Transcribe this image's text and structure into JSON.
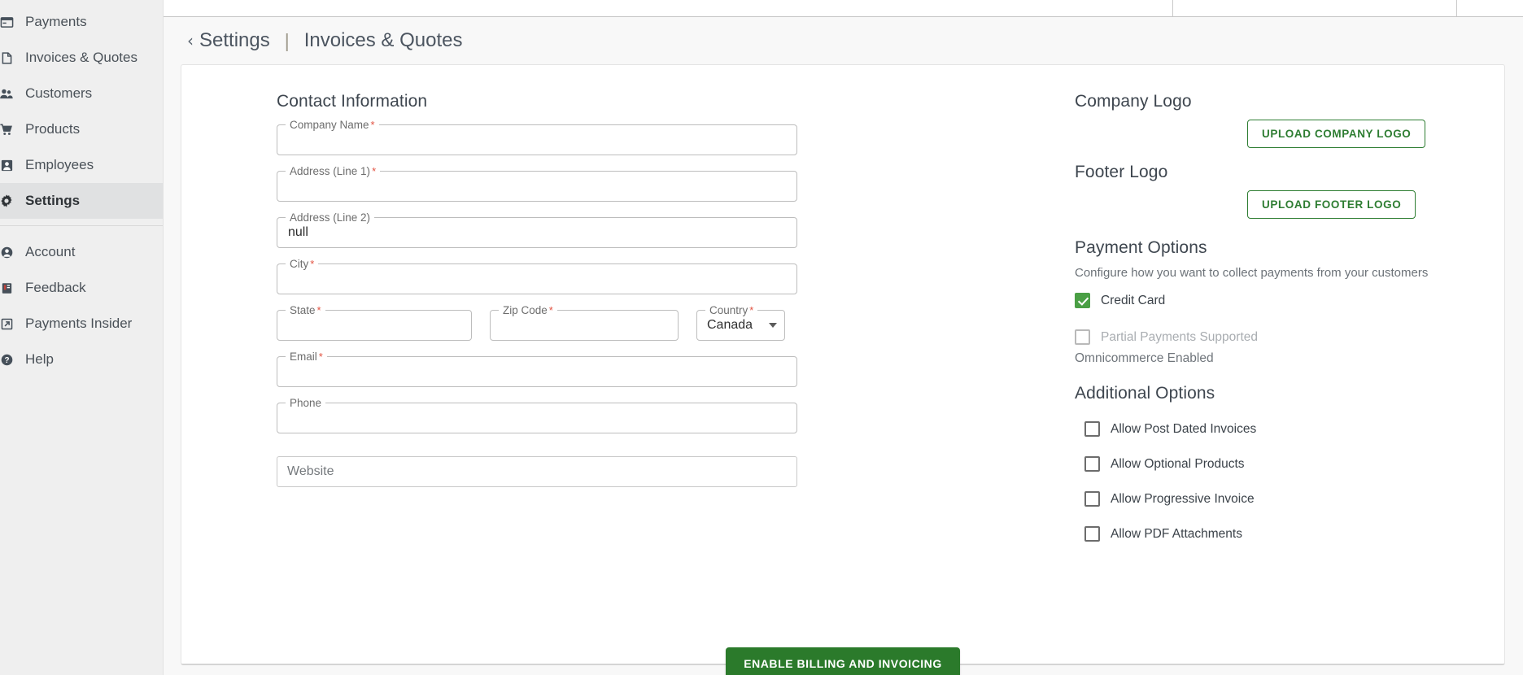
{
  "sidebar": {
    "items": [
      {
        "label": "Payments",
        "icon": "payments-icon",
        "active": false
      },
      {
        "label": "Invoices & Quotes",
        "icon": "invoice-icon",
        "active": false
      },
      {
        "label": "Customers",
        "icon": "customers-icon",
        "active": false
      },
      {
        "label": "Products",
        "icon": "products-cart-icon",
        "active": false
      },
      {
        "label": "Employees",
        "icon": "employees-icon",
        "active": false
      },
      {
        "label": "Settings",
        "icon": "gear-icon",
        "active": true
      }
    ],
    "secondary_items": [
      {
        "label": "Account",
        "icon": "account-icon"
      },
      {
        "label": "Feedback",
        "icon": "feedback-icon"
      },
      {
        "label": "Payments Insider",
        "icon": "external-link-icon"
      },
      {
        "label": "Help",
        "icon": "help-icon"
      }
    ]
  },
  "header": {
    "back_label": "Settings",
    "separator": "|",
    "current": "Invoices & Quotes"
  },
  "contact": {
    "title": "Contact Information",
    "fields": {
      "company_name": {
        "label": "Company Name",
        "required_mark": "*",
        "value": ""
      },
      "address_line1": {
        "label": "Address (Line 1)",
        "required_mark": "*",
        "value": ""
      },
      "address_line2": {
        "label": "Address (Line 2)",
        "required_mark": "",
        "value": "null"
      },
      "city": {
        "label": "City",
        "required_mark": "*",
        "value": ""
      },
      "state": {
        "label": "State",
        "required_mark": "*",
        "value": ""
      },
      "zip": {
        "label": "Zip Code",
        "required_mark": "*",
        "value": ""
      },
      "country": {
        "label": "Country",
        "required_mark": "*",
        "value": "Canada"
      },
      "email": {
        "label": "Email",
        "required_mark": "*",
        "value": ""
      },
      "phone": {
        "label": "Phone",
        "required_mark": "",
        "value": ""
      },
      "website": {
        "placeholder": "Website",
        "value": ""
      }
    }
  },
  "logos": {
    "company_title": "Company Logo",
    "company_button": "UPLOAD COMPANY LOGO",
    "footer_title": "Footer Logo",
    "footer_button": "UPLOAD FOOTER LOGO"
  },
  "payment_options": {
    "title": "Payment Options",
    "subtitle": "Configure how you want to collect payments from your customers",
    "items": [
      {
        "label": "Credit Card",
        "checked": true,
        "disabled": false
      },
      {
        "label": "Partial Payments Supported",
        "checked": false,
        "disabled": true
      }
    ],
    "note": "Omnicommerce Enabled"
  },
  "additional_options": {
    "title": "Additional Options",
    "items": [
      {
        "label": "Allow Post Dated Invoices",
        "checked": false
      },
      {
        "label": "Allow Optional Products",
        "checked": false
      },
      {
        "label": "Allow Progressive Invoice",
        "checked": false
      },
      {
        "label": "Allow PDF Attachments",
        "checked": false
      }
    ]
  },
  "actions": {
    "primary_button": "ENABLE BILLING AND INVOICING"
  },
  "colors": {
    "brand_green": "#2b7a2b",
    "outline_green": "#2e7d32",
    "checkbox_green": "#4a9f45",
    "required_red": "#e25241",
    "sidebar_bg": "#efefef",
    "active_nav_bg": "#e0e1e2",
    "page_bg": "#f8f8f8"
  }
}
